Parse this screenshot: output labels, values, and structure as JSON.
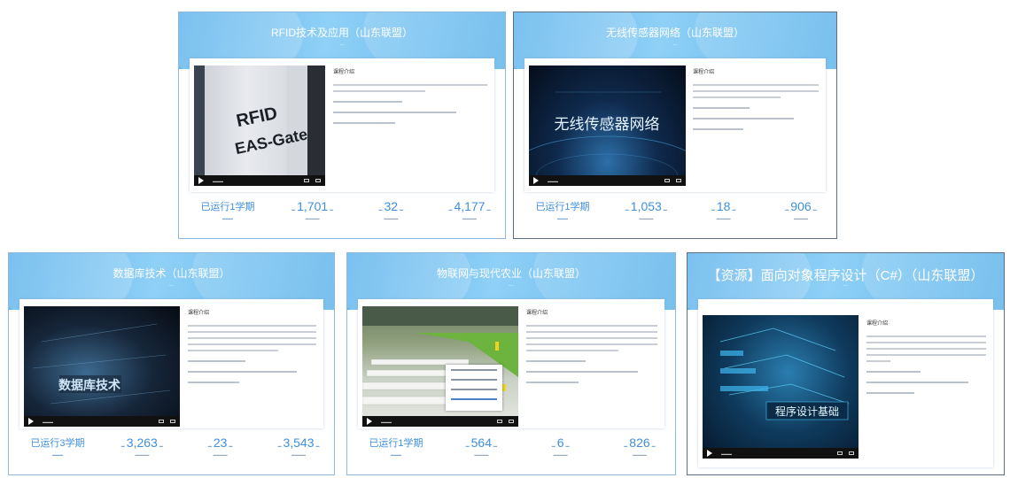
{
  "courses": [
    {
      "title": "RFID技术及应用（山东联盟）",
      "intro_label": "课程介绍",
      "video_text": [
        "RFID",
        "EAS-Gate"
      ],
      "term": "已运行1学期",
      "stats": [
        "1,701",
        "32",
        "4,177"
      ]
    },
    {
      "title": "无线传感器网络（山东联盟）",
      "intro_label": "课程介绍",
      "video_text": [
        "无线传感器网络"
      ],
      "term": "已运行1学期",
      "stats": [
        "1,053",
        "18",
        "906"
      ]
    },
    {
      "title": "数据库技术（山东联盟）",
      "intro_label": "课程介绍",
      "video_text": [
        "数据库技术"
      ],
      "term": "已运行3学期",
      "stats": [
        "3,263",
        "23",
        "3,543"
      ]
    },
    {
      "title": "物联网与现代农业（山东联盟）",
      "intro_label": "课程介绍",
      "video_text": [],
      "term": "已运行1学期",
      "stats": [
        "564",
        "6",
        "826"
      ]
    },
    {
      "title": "【资源】面向对象程序设计（C#）（山东联盟）",
      "intro_label": "课程介绍",
      "video_text": [
        "程序设计基础"
      ]
    }
  ]
}
